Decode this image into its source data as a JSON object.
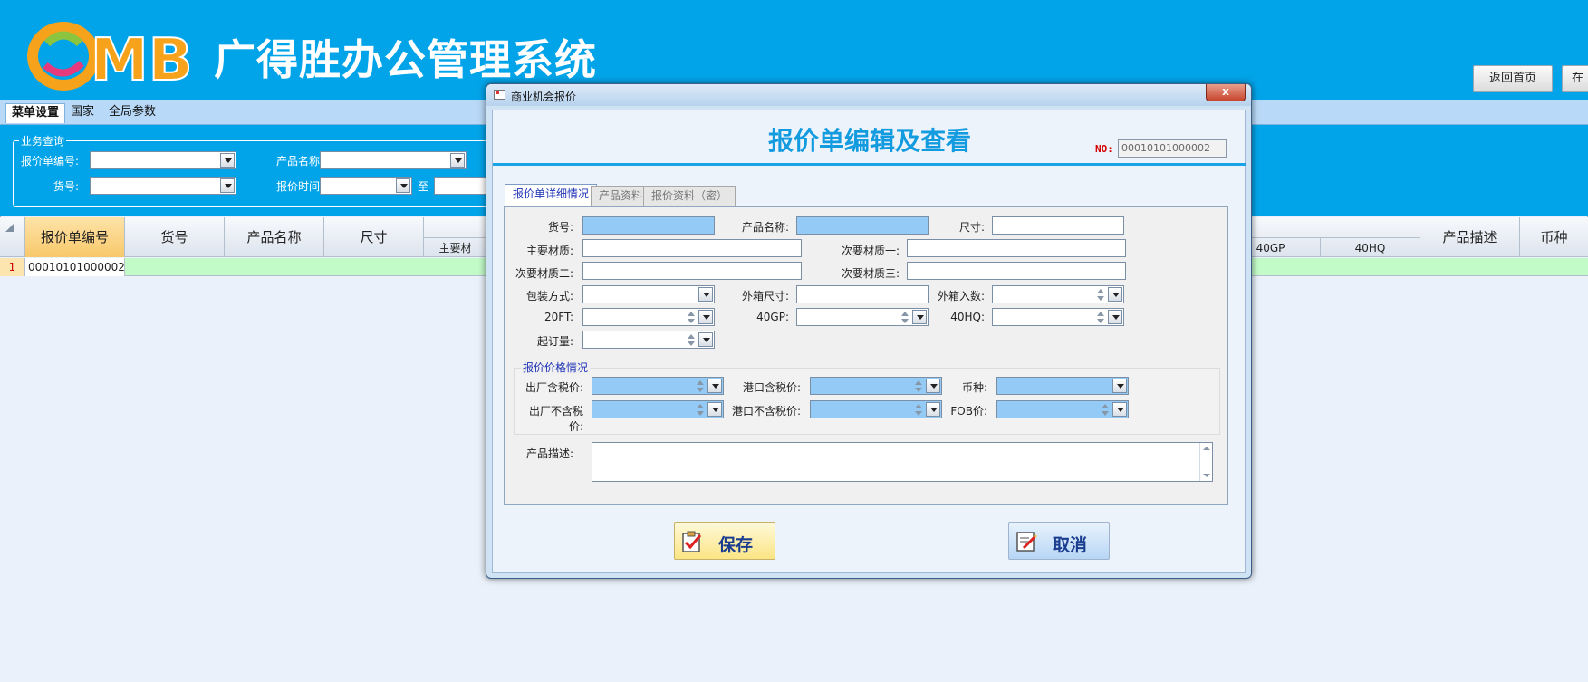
{
  "app": {
    "title": "广得胜办公管理系统",
    "logo_text": "OMB"
  },
  "header_buttons": [
    "返回首页",
    "在"
  ],
  "tabs": [
    "菜单设置",
    "国家",
    "全局参数"
  ],
  "query": {
    "legend": "业务查询",
    "fields": {
      "quote_no": "报价单编号:",
      "product_name": "产品名称:",
      "item_no": "货号:",
      "quote_time": "报价时间:",
      "to": "至"
    }
  },
  "grid": {
    "columns": [
      "报价单编号",
      "货号",
      "产品名称",
      "尺寸",
      "主要材",
      "40GP",
      "40HQ",
      "产品描述",
      "币种"
    ],
    "rows": [
      {
        "num": "1",
        "quote_no": "00010101000002"
      }
    ]
  },
  "dialog": {
    "title": "商业机会报价",
    "close": "x",
    "heading": "报价单编辑及查看",
    "no_label": "NO:",
    "no_value": "00010101000002",
    "tabs": [
      "报价单详细情况",
      "产品资料",
      "报价资料（密）"
    ],
    "labels": {
      "item_no": "货号:",
      "product_name": "产品名称:",
      "size": "尺寸:",
      "main_material": "主要材质:",
      "sub_material_1": "次要材质一:",
      "sub_material_2": "次要材质二:",
      "sub_material_3": "次要材质三:",
      "packing": "包装方式:",
      "carton_size": "外箱尺寸:",
      "carton_qty": "外箱入数:",
      "ft20": "20FT:",
      "gp40": "40GP:",
      "hq40": "40HQ:",
      "moq": "起订量:",
      "price_group": "报价价格情况",
      "factory_tax": "出厂含税价:",
      "port_tax": "港口含税价:",
      "currency": "币种:",
      "factory_notax": "出厂不含税价:",
      "port_notax": "港口不含税价:",
      "fob": "FOB价:",
      "description": "产品描述:"
    },
    "buttons": {
      "save": "保存",
      "cancel": "取消"
    }
  }
}
